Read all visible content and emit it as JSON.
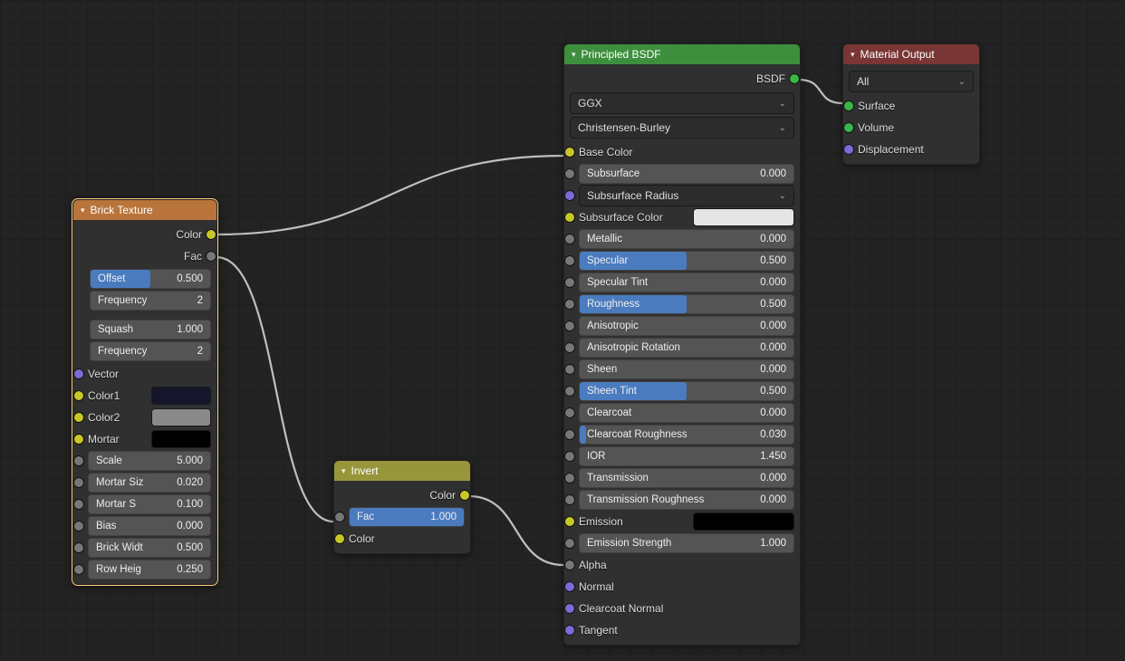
{
  "brick": {
    "title": "Brick Texture",
    "out_color": "Color",
    "out_fac": "Fac",
    "offset": {
      "name": "Offset",
      "value": "0.500",
      "fill": 0.5
    },
    "freq1": {
      "name": "Frequency",
      "value": "2",
      "fill": 0
    },
    "squash": {
      "name": "Squash",
      "value": "1.000",
      "fill": 0
    },
    "freq2": {
      "name": "Frequency",
      "value": "2",
      "fill": 0
    },
    "vector": "Vector",
    "color1": "Color1",
    "color2": "Color2",
    "mortar": "Mortar",
    "color1_hex": "#15152b",
    "color2_hex": "#8a8a8a",
    "mortar_hex": "#000000",
    "scale": {
      "name": "Scale",
      "value": "5.000"
    },
    "mortar_size": {
      "name": "Mortar Siz",
      "value": "0.020"
    },
    "mortar_s": {
      "name": "Mortar S",
      "value": "0.100"
    },
    "bias": {
      "name": "Bias",
      "value": "0.000"
    },
    "brick_w": {
      "name": "Brick Widt",
      "value": "0.500"
    },
    "row_h": {
      "name": "Row Heig",
      "value": "0.250"
    }
  },
  "invert": {
    "title": "Invert",
    "out_color": "Color",
    "fac": {
      "name": "Fac",
      "value": "1.000",
      "fill": 1
    },
    "in_color": "Color"
  },
  "bsdf": {
    "title": "Principled BSDF",
    "out": "BSDF",
    "sel1": "GGX",
    "sel2": "Christensen-Burley",
    "base_color": "Base Color",
    "subsurface": {
      "name": "Subsurface",
      "value": "0.000",
      "fill": 0
    },
    "subsurface_radius": "Subsurface Radius",
    "subsurface_color": "Subsurface Color",
    "subsurface_color_hex": "#e5e5e5",
    "metallic": {
      "name": "Metallic",
      "value": "0.000",
      "fill": 0
    },
    "specular": {
      "name": "Specular",
      "value": "0.500",
      "fill": 0.5
    },
    "specular_tint": {
      "name": "Specular Tint",
      "value": "0.000",
      "fill": 0
    },
    "roughness": {
      "name": "Roughness",
      "value": "0.500",
      "fill": 0.5
    },
    "anisotropic": {
      "name": "Anisotropic",
      "value": "0.000",
      "fill": 0
    },
    "anisotropic_rot": {
      "name": "Anisotropic Rotation",
      "value": "0.000",
      "fill": 0
    },
    "sheen": {
      "name": "Sheen",
      "value": "0.000",
      "fill": 0
    },
    "sheen_tint": {
      "name": "Sheen Tint",
      "value": "0.500",
      "fill": 0.5
    },
    "clearcoat": {
      "name": "Clearcoat",
      "value": "0.000",
      "fill": 0
    },
    "clearcoat_rough": {
      "name": "Clearcoat Roughness",
      "value": "0.030",
      "fill": 0.01
    },
    "ior": {
      "name": "IOR",
      "value": "1.450",
      "fill": 0
    },
    "transmission": {
      "name": "Transmission",
      "value": "0.000",
      "fill": 0
    },
    "transmission_rough": {
      "name": "Transmission Roughness",
      "value": "0.000",
      "fill": 0
    },
    "emission": "Emission",
    "emission_hex": "#000000",
    "emission_strength": {
      "name": "Emission Strength",
      "value": "1.000",
      "fill": 0
    },
    "alpha": "Alpha",
    "normal": "Normal",
    "clearcoat_normal": "Clearcoat Normal",
    "tangent": "Tangent"
  },
  "output": {
    "title": "Material Output",
    "sel": "All",
    "surface": "Surface",
    "volume": "Volume",
    "displacement": "Displacement"
  }
}
